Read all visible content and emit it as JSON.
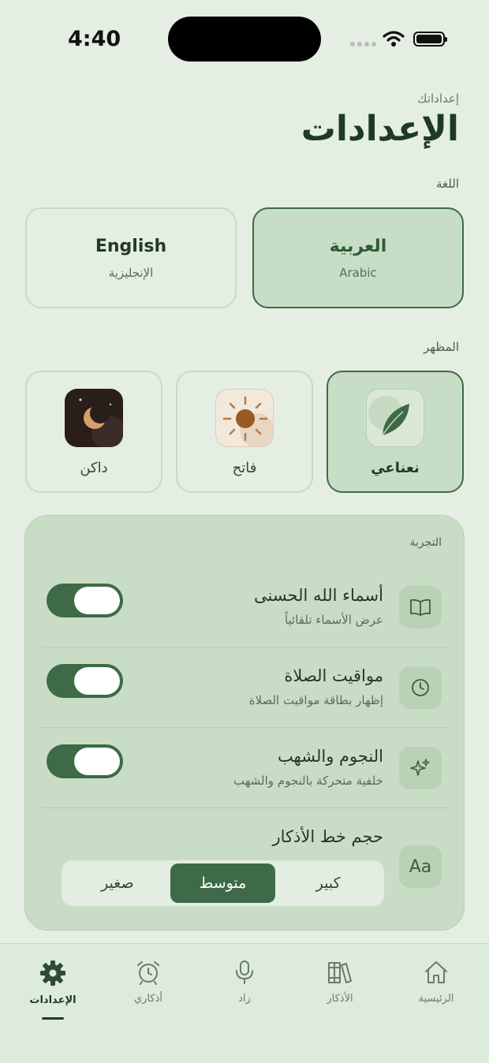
{
  "status_bar": {
    "time": "4:40"
  },
  "header": {
    "subtitle": "إعداداتك",
    "title": "الإعدادات"
  },
  "language": {
    "section_label": "اللغة",
    "options": [
      {
        "label": "العربية",
        "sublabel": "Arabic",
        "selected": true
      },
      {
        "label": "English",
        "sublabel": "الإنجليزية",
        "selected": false
      }
    ]
  },
  "appearance": {
    "section_label": "المظهر",
    "options": [
      {
        "label": "نعناعي",
        "icon": "leaf-icon",
        "selected": true
      },
      {
        "label": "فاتح",
        "icon": "sun-icon",
        "selected": false
      },
      {
        "label": "داكن",
        "icon": "moon-icon",
        "selected": false
      }
    ]
  },
  "experience": {
    "section_label": "التجربة",
    "rows": [
      {
        "title": "أسماء الله الحسنى",
        "description": "عرض الأسماء تلقائياً",
        "icon": "book-icon",
        "enabled": true
      },
      {
        "title": "مواقيت الصلاة",
        "description": "إظهار بطاقة مواقيت الصلاة",
        "icon": "clock-icon",
        "enabled": true
      },
      {
        "title": "النجوم والشهب",
        "description": "خلفية متحركة بالنجوم والشهب",
        "icon": "sparkles-icon",
        "enabled": true
      }
    ],
    "font_size": {
      "title": "حجم خط الأذكار",
      "icon_text": "Aa",
      "options": [
        "كبير",
        "متوسط",
        "صغير"
      ],
      "selected": "متوسط"
    }
  },
  "tabs": [
    {
      "label": "الرئيسية",
      "icon": "home-icon",
      "active": false
    },
    {
      "label": "الأذكار",
      "icon": "books-icon",
      "active": false
    },
    {
      "label": "زاد",
      "icon": "microphone-icon",
      "active": false
    },
    {
      "label": "أذكاري",
      "icon": "alarm-clock-icon",
      "active": false
    },
    {
      "label": "الإعدادات",
      "icon": "gear-icon",
      "active": true
    }
  ],
  "colors": {
    "background": "#e4eee2",
    "accent": "#3e6a47",
    "selected_card": "#c8ddc5",
    "text_primary": "#22392a"
  }
}
